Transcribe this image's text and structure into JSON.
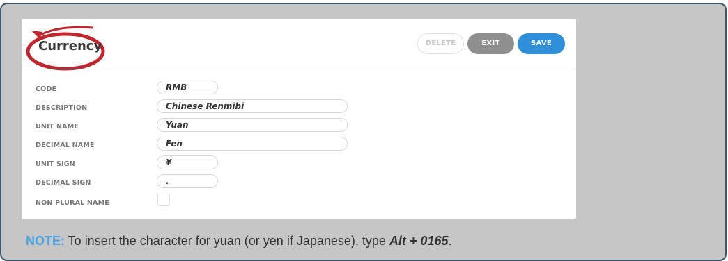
{
  "header": {
    "title": "Currency"
  },
  "buttons": {
    "delete": "DELETE",
    "exit": "EXIT",
    "save": "SAVE"
  },
  "fields": [
    {
      "label": "CODE",
      "value": "RMB"
    },
    {
      "label": "DESCRIPTION",
      "value": "Chinese Renmibi"
    },
    {
      "label": "UNIT NAME",
      "value": "Yuan"
    },
    {
      "label": "DECIMAL NAME",
      "value": "Fen"
    },
    {
      "label": "UNIT SIGN",
      "value": "¥"
    },
    {
      "label": "DECIMAL SIGN",
      "value": "."
    },
    {
      "label": "NON PLURAL NAME",
      "checked": false
    }
  ],
  "note": {
    "prefix": "NOTE:",
    "text": " To insert the character for yuan (or yen if Japanese), type ",
    "keys": "Alt + 0165",
    "suffix": "."
  },
  "colors": {
    "annotation": "#c0262d",
    "accent": "#2f8fd8",
    "note_label": "#4aa3df",
    "frame_border": "#3b556a"
  },
  "icons": {
    "annotation": "red-circle-annotation"
  }
}
